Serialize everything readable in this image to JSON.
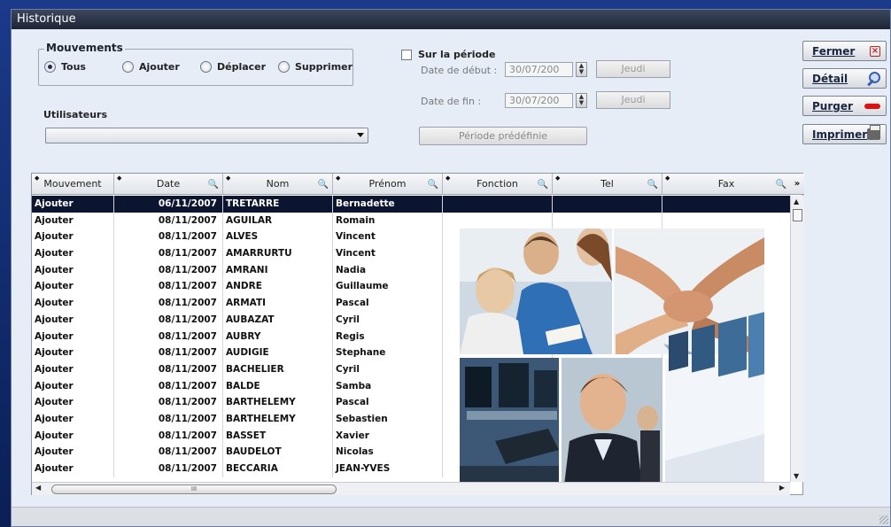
{
  "window": {
    "title": "Historique"
  },
  "mouvements": {
    "title": "Mouvements",
    "options": [
      {
        "label": "Tous",
        "selected": true
      },
      {
        "label": "Ajouter",
        "selected": false
      },
      {
        "label": "Déplacer",
        "selected": false
      },
      {
        "label": "Supprimer",
        "selected": false
      }
    ]
  },
  "utilisateurs": {
    "label": "Utilisateurs",
    "value": ""
  },
  "periode": {
    "checkbox_label": "Sur la période",
    "checked": false,
    "start_label": "Date de début :",
    "start_value": "30/07/200",
    "start_day": "Jeudi",
    "end_label": "Date de fin :",
    "end_value": "30/07/200",
    "end_day": "Jeudi",
    "predefined_label": "Période prédéfinie"
  },
  "actions": {
    "fermer": "Fermer",
    "detail": "Détail",
    "purger": "Purger",
    "imprimer": "Imprimer"
  },
  "table": {
    "columns": [
      "Mouvement",
      "Date",
      "Nom",
      "Prénom",
      "Fonction",
      "Tel",
      "Fax"
    ],
    "rows": [
      [
        "Ajouter",
        "06/11/2007",
        "TRETARRE",
        "Bernadette"
      ],
      [
        "Ajouter",
        "08/11/2007",
        "AGUILAR",
        "Romain"
      ],
      [
        "Ajouter",
        "08/11/2007",
        "ALVES",
        "Vincent"
      ],
      [
        "Ajouter",
        "08/11/2007",
        "AMARRURTU",
        "Vincent"
      ],
      [
        "Ajouter",
        "08/11/2007",
        "AMRANI",
        "Nadia"
      ],
      [
        "Ajouter",
        "08/11/2007",
        "ANDRE",
        "Guillaume"
      ],
      [
        "Ajouter",
        "08/11/2007",
        "ARMATI",
        "Pascal"
      ],
      [
        "Ajouter",
        "08/11/2007",
        "AUBAZAT",
        "Cyril"
      ],
      [
        "Ajouter",
        "08/11/2007",
        "AUBRY",
        "Regis"
      ],
      [
        "Ajouter",
        "08/11/2007",
        "AUDIGIE",
        "Stephane"
      ],
      [
        "Ajouter",
        "08/11/2007",
        "BACHELIER",
        "Cyril"
      ],
      [
        "Ajouter",
        "08/11/2007",
        "BALDE",
        "Samba"
      ],
      [
        "Ajouter",
        "08/11/2007",
        "BARTHELEMY",
        "Pascal"
      ],
      [
        "Ajouter",
        "08/11/2007",
        "BARTHELEMY",
        "Sebastien"
      ],
      [
        "Ajouter",
        "08/11/2007",
        "BASSET",
        "Xavier"
      ],
      [
        "Ajouter",
        "08/11/2007",
        "BAUDELOT",
        "Nicolas"
      ],
      [
        "Ajouter",
        "08/11/2007",
        "BECCARIA",
        "JEAN-YVES"
      ]
    ],
    "selected_row": 0
  },
  "scrollbar": {
    "grip": "III"
  }
}
